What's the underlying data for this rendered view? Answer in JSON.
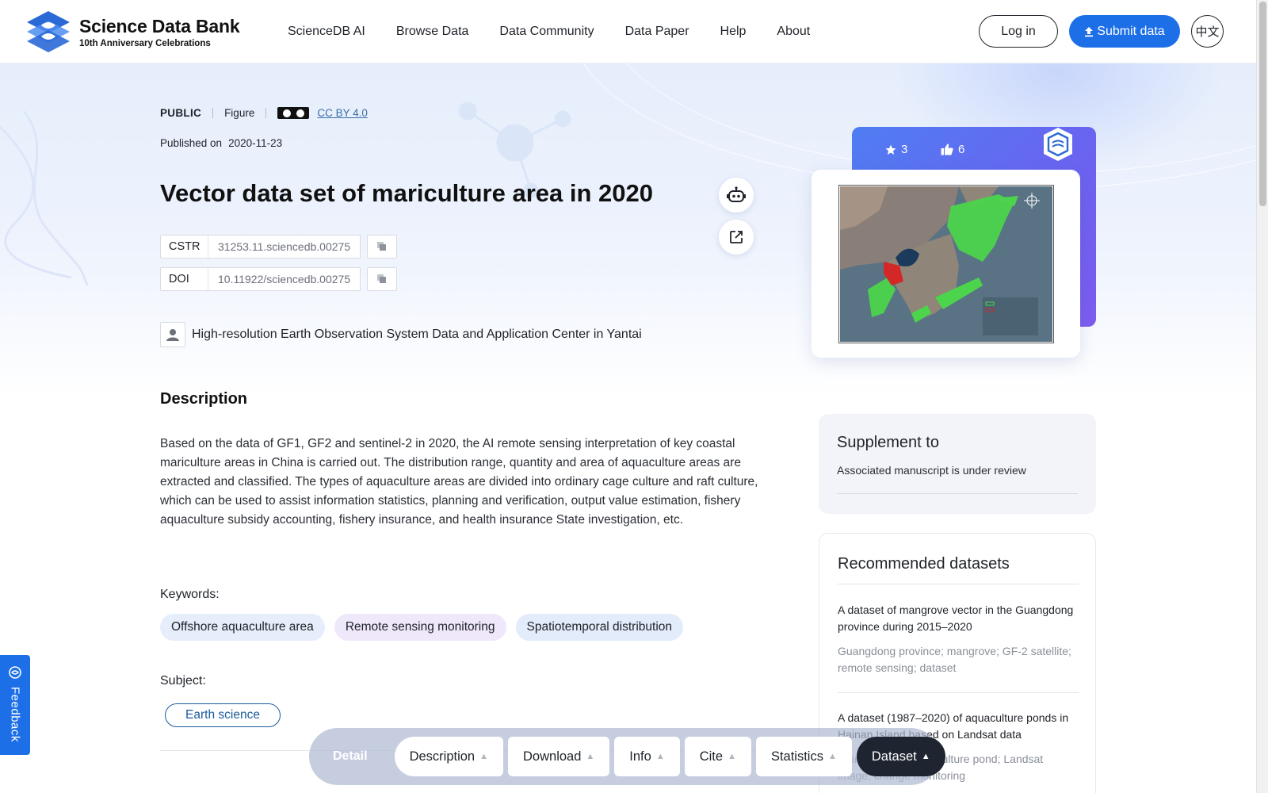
{
  "header": {
    "logo_title": "Science Data Bank",
    "logo_subtitle": "10th Anniversary Celebrations",
    "nav": [
      "ScienceDB AI",
      "Browse Data",
      "Data Community",
      "Data Paper",
      "Help",
      "About"
    ],
    "login_label": "Log in",
    "submit_label": "Submit data",
    "lang_label": "中文"
  },
  "dataset": {
    "visibility": "PUBLIC",
    "type": "Figure",
    "license": "CC BY 4.0",
    "published_label": "Published on",
    "published_date": "2020-11-23",
    "title": "Vector data set of mariculture area in 2020",
    "cstr_label": "CSTR",
    "cstr_value": "31253.11.sciencedb.00275",
    "doi_label": "DOI",
    "doi_value": "10.11922/sciencedb.00275",
    "author": "High-resolution Earth Observation System Data and Application Center in Yantai"
  },
  "description": {
    "heading": "Description",
    "text": "Based on the data of GF1, GF2 and sentinel-2 in 2020, the AI remote sensing interpretation of key coastal mariculture areas in China is carried out. The distribution range, quantity and area of aquaculture areas are extracted and classified. The types of aquaculture areas are divided into ordinary cage culture and raft culture, which can be used to assist information statistics, planning and verification, output value estimation, fishery aquaculture subsidy accounting, fishery insurance, and health insurance State investigation, etc."
  },
  "keywords": {
    "label": "Keywords:",
    "items": [
      "Offshore aquaculture area",
      "Remote sensing monitoring",
      "Spatiotemporal distribution"
    ]
  },
  "subject": {
    "label": "Subject:",
    "value": "Earth science"
  },
  "stats": {
    "stars": "3",
    "likes": "6"
  },
  "supplement": {
    "heading": "Supplement to",
    "text": "Associated manuscript is under review"
  },
  "recommended": {
    "heading": "Recommended datasets",
    "items": [
      {
        "title": "A dataset of mangrove vector in the Guangdong province during 2015–2020",
        "keywords": "Guangdong province; mangrove; GF-2 satellite; remote sensing; dataset"
      },
      {
        "title": "A dataset (1987–2020) of aquaculture ponds in Hainan Island based on Landsat data",
        "keywords": "Hainan Island; aquaculture pond; Landsat image; change monitoring"
      }
    ]
  },
  "feedback_label": "Feedback",
  "bottom_nav": {
    "detail": "Detail",
    "items": [
      "Description",
      "Download",
      "Info",
      "Cite",
      "Statistics",
      "Dataset"
    ],
    "active": "Dataset"
  },
  "colors": {
    "brand_blue": "#1d6fe8",
    "dark": "#1e2530",
    "subject": "#1a5a9c"
  }
}
